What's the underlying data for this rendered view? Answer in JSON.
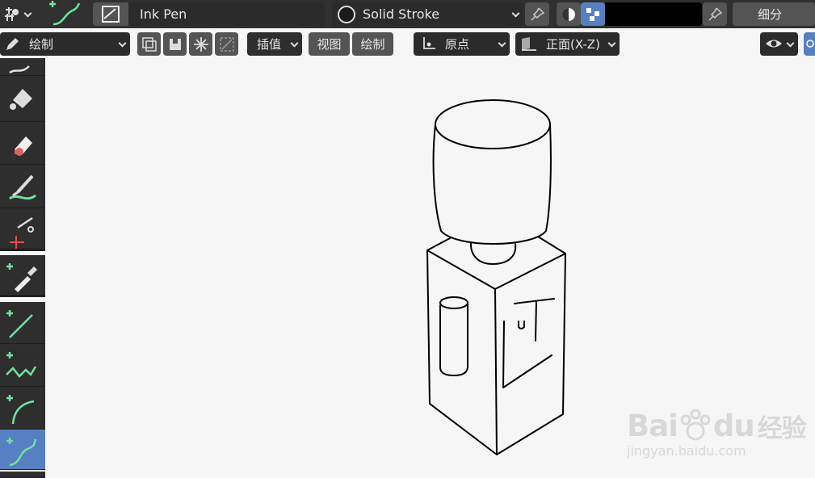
{
  "header": {
    "brush_name": "Ink Pen",
    "material_name": "Solid Stroke",
    "subdivide_label": "细分"
  },
  "toolbar": {
    "mode_label": "绘制",
    "interpolate_label": "插值",
    "view_label": "视图",
    "draw_label": "绘制",
    "pivot_label": "原点",
    "orientation_label": "正面(X-Z)"
  },
  "sidebar": {
    "items": [
      {
        "name": "draw"
      },
      {
        "name": "fill"
      },
      {
        "name": "erase"
      },
      {
        "name": "tint"
      },
      {
        "name": "cutter"
      },
      {
        "name": "eyedropper"
      },
      {
        "name": "line"
      },
      {
        "name": "polyline"
      },
      {
        "name": "arc"
      },
      {
        "name": "curve"
      }
    ]
  },
  "watermark": {
    "brand": "Bai",
    "brand_suffix": "du",
    "product": "经验",
    "url": "jingyan.baidu.com"
  },
  "colors": {
    "accent": "#5680c2",
    "tool_green": "#6fe3a0",
    "stroke_color": "#000000"
  }
}
